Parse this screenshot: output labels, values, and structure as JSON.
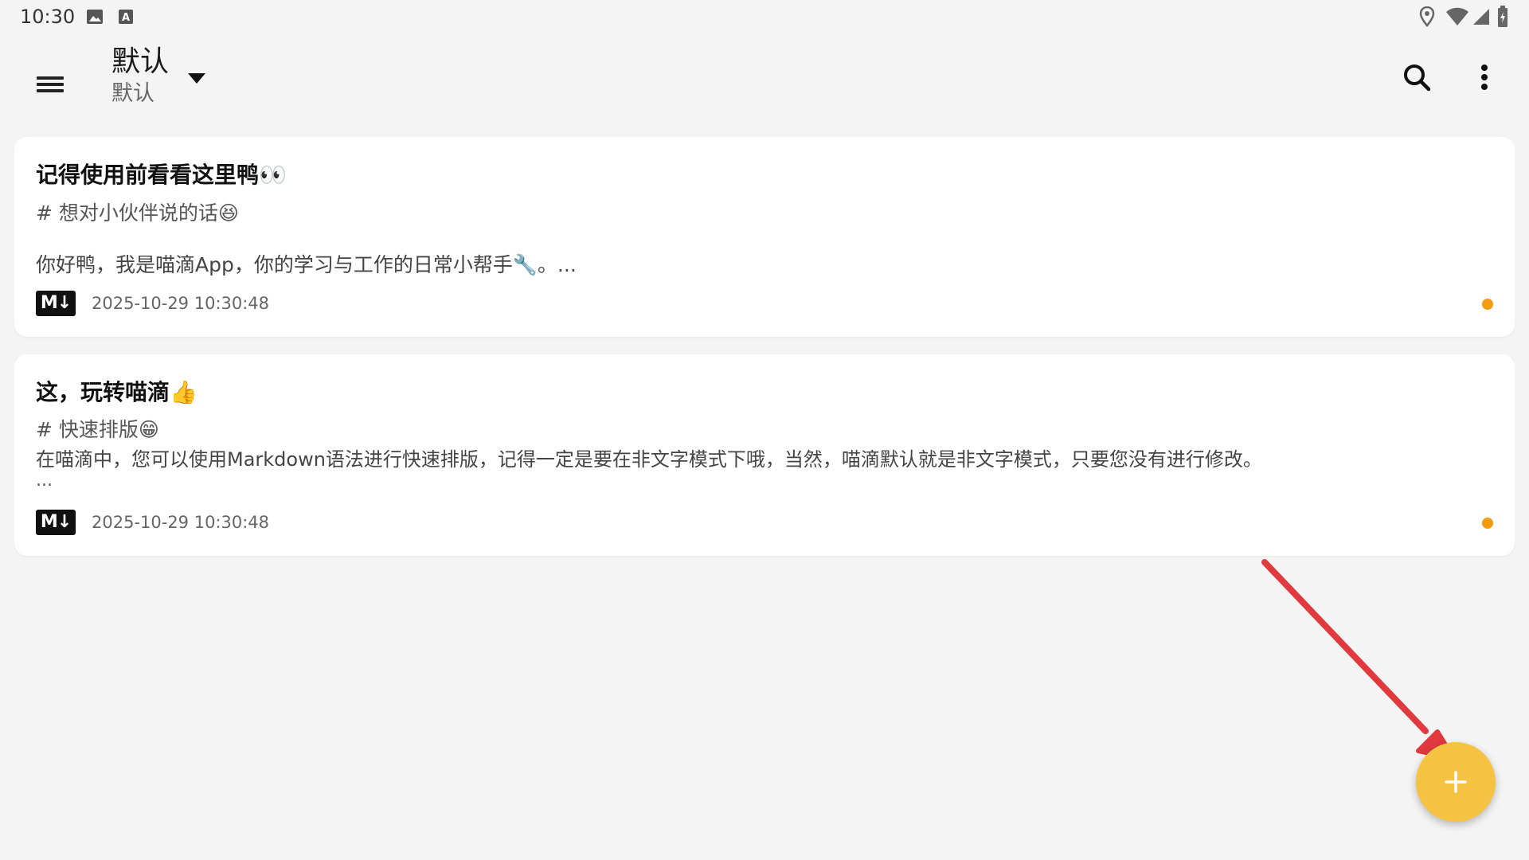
{
  "status_bar": {
    "time": "10:30",
    "left_icons": [
      "image-icon",
      "keyboard-a-icon"
    ],
    "right_icons": [
      "location-icon",
      "wifi-icon",
      "signal-icon",
      "battery-icon"
    ]
  },
  "app_bar": {
    "title": "默认",
    "subtitle": "默认",
    "icons": {
      "menu": "hamburger-menu-icon",
      "dropdown": "caret-down-icon",
      "search": "search-icon",
      "more": "more-vertical-icon"
    }
  },
  "notes": [
    {
      "title": "记得使用前看看这里鸭👀",
      "tag": "# 想对小伙伴说的话😆",
      "body": "你好鸭，我是喵滴App，你的学习与工作的日常小帮手🔧。...",
      "badge": "M↓",
      "timestamp": "2025-10-29 10:30:48",
      "dot_color": "#f39c12"
    },
    {
      "title": "这，玩转喵滴👍",
      "tag": "# 快速排版😁",
      "body": "在喵滴中，您可以使用Markdown语法进行快速排版，记得一定是要在非文字模式下哦，当然，喵滴默认就是非文字模式，只要您没有进行修改。",
      "ellipsis": "...",
      "badge": "M↓",
      "timestamp": "2025-10-29 10:30:48",
      "dot_color": "#f39c12"
    }
  ],
  "fab": {
    "label": "+",
    "icon": "plus-icon",
    "color": "#f5c242"
  },
  "annotation": {
    "arrow_color": "#e0393e"
  },
  "colors": {
    "background": "#f4f4f4",
    "card": "#ffffff",
    "accent": "#f5c242"
  }
}
